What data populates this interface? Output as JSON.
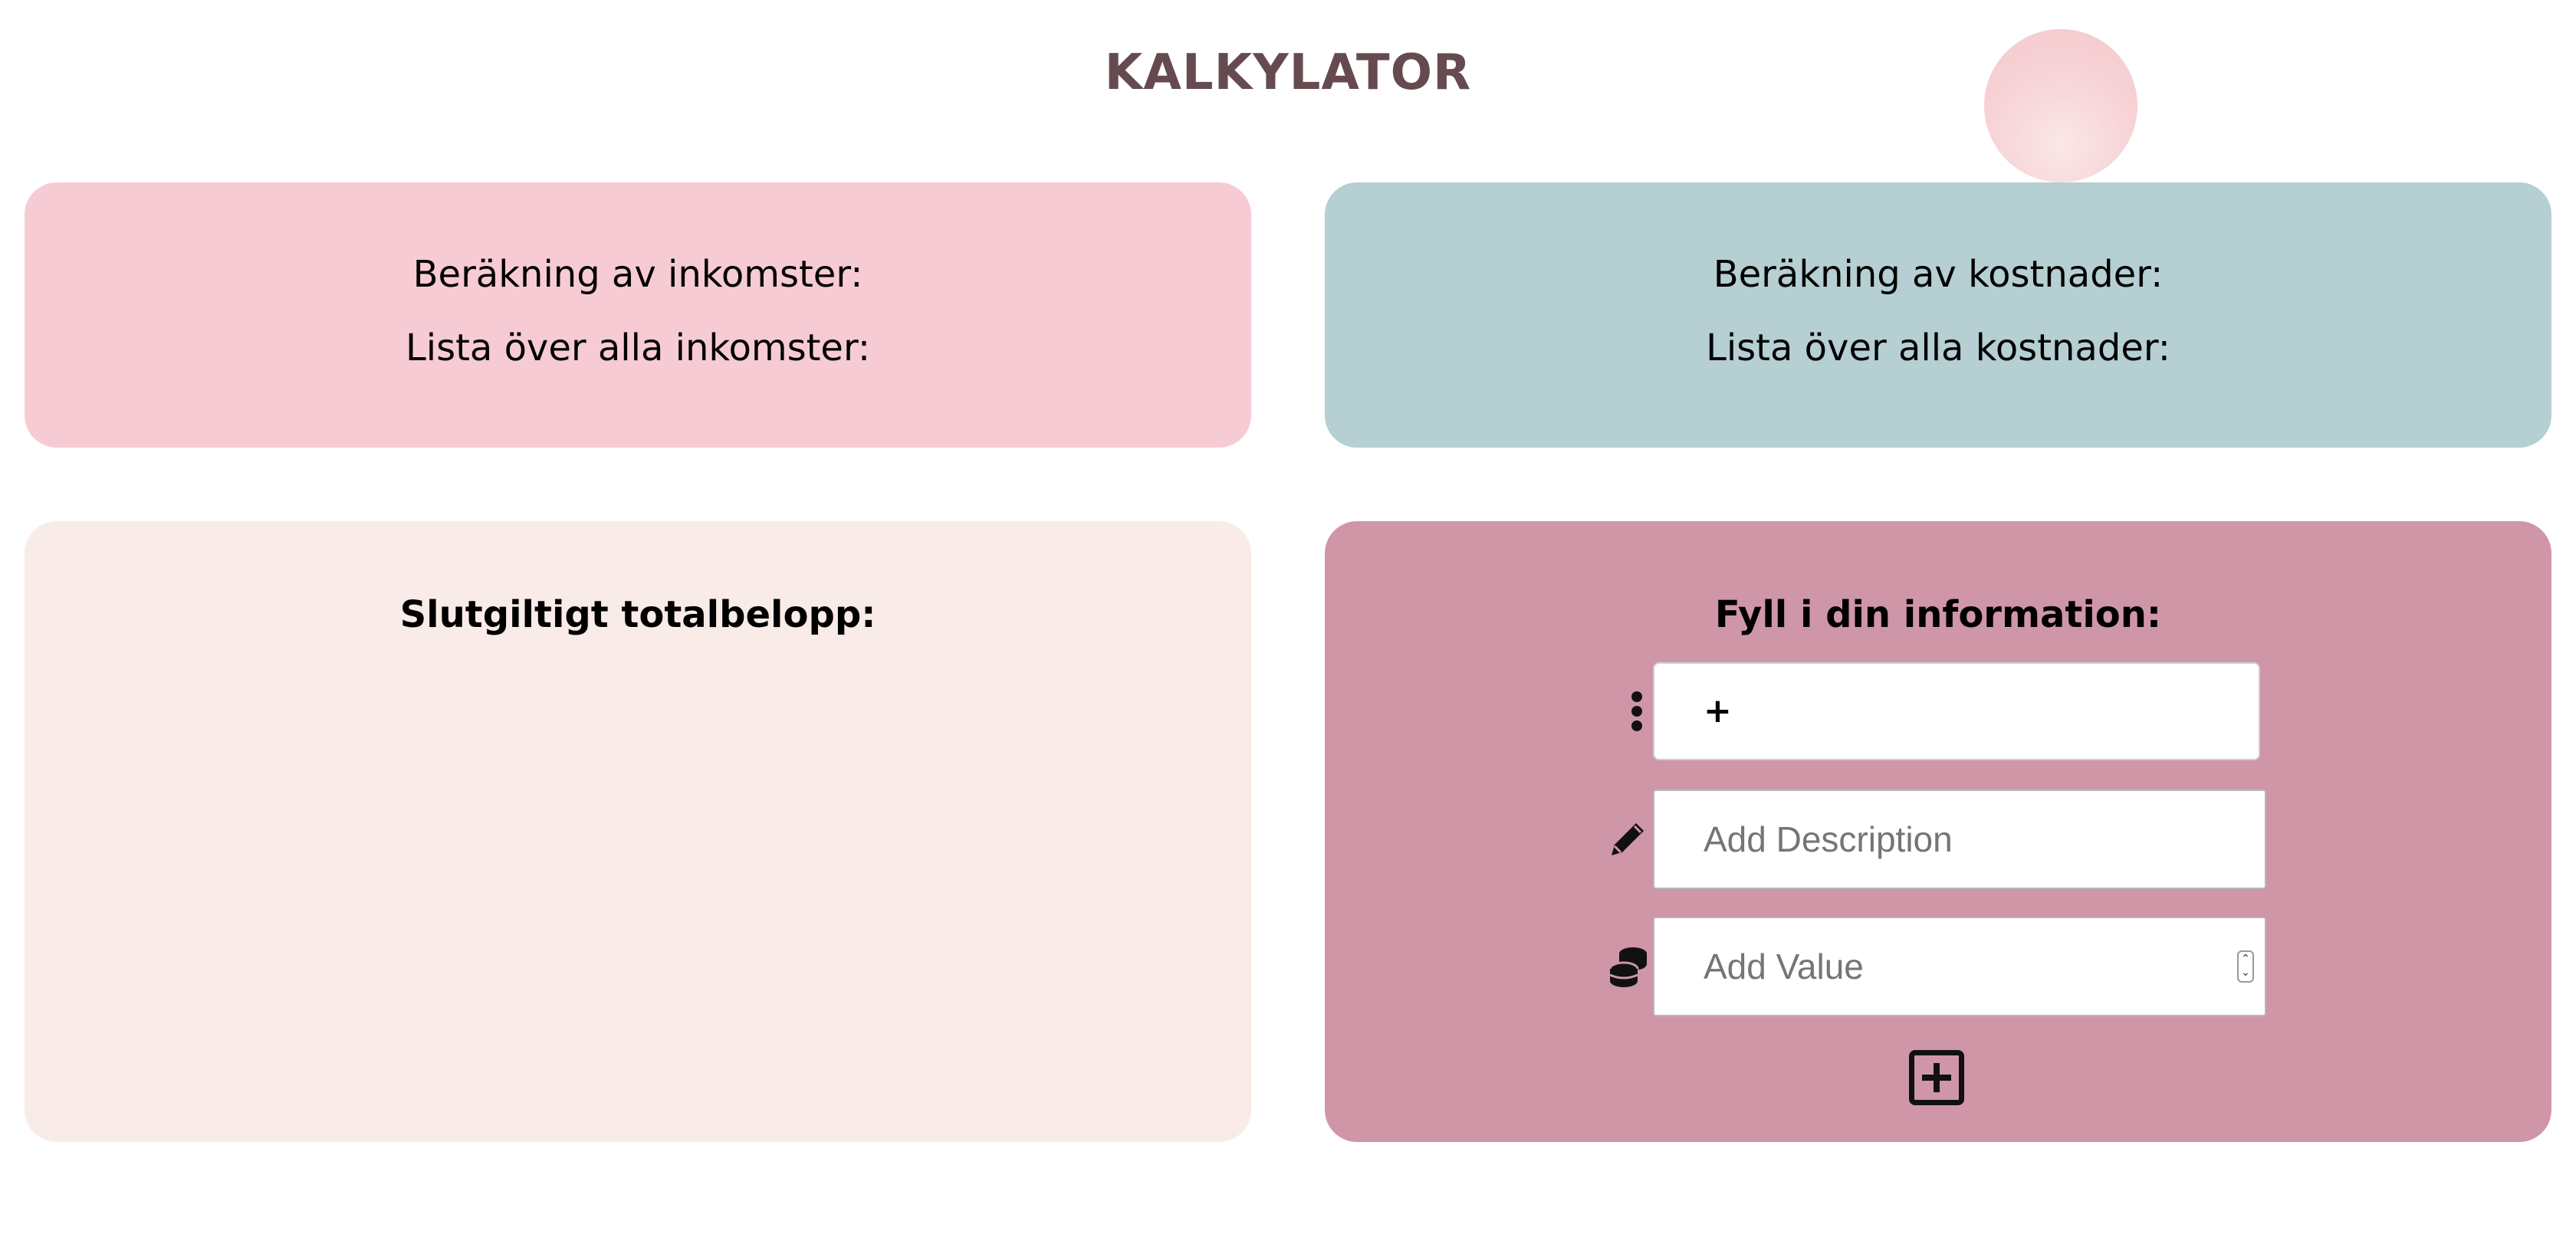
{
  "app_title": "KALKYLATOR",
  "income": {
    "calc_label": "Beräkning av inkomster:",
    "list_label": "Lista över alla inkomster:"
  },
  "costs": {
    "calc_label": "Beräkning av kostnader:",
    "list_label": "Lista över alla kostnader:"
  },
  "total": {
    "heading": "Slutgiltigt totalbelopp:"
  },
  "form": {
    "heading": "Fyll i din information:",
    "type_value": "+",
    "description_placeholder": "Add Description",
    "value_placeholder": "Add Value",
    "icons": [
      "vertical-dots-icon",
      "pencil-icon",
      "coins-icon",
      "plus-square-icon"
    ]
  },
  "colors": {
    "title": "#654b4f",
    "income_card": "#f7cbd4",
    "cost_card": "#b5cfd3",
    "total_card": "#f9ebe8",
    "form_card": "#cf96a8"
  }
}
